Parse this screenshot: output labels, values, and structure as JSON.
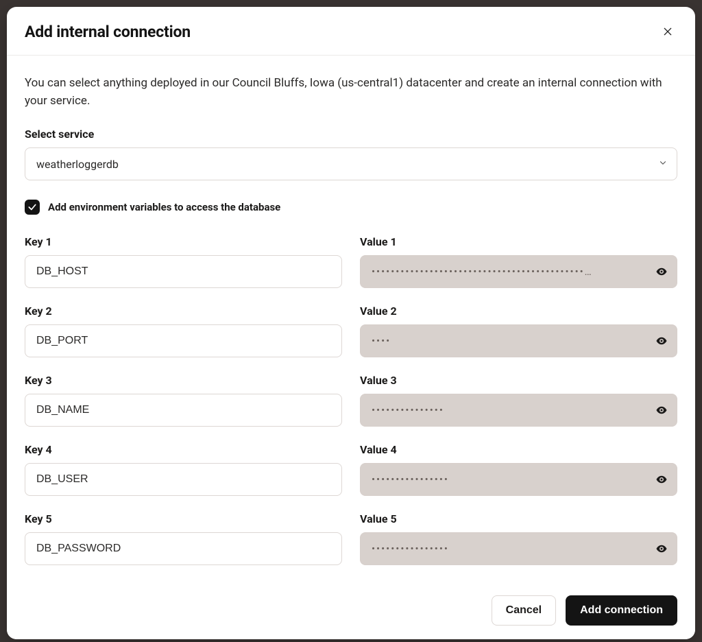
{
  "dialog": {
    "title": "Add internal connection",
    "intro": "You can select anything deployed in our Council Bluffs, Iowa (us-central1) datacenter and create an internal connection with your service.",
    "select_label": "Select service",
    "selected_service": "weatherloggerdb",
    "checkbox_label": "Add environment variables to access the database",
    "checkbox_checked": true,
    "pairs": [
      {
        "key_label": "Key 1",
        "value_label": "Value 1",
        "key": "DB_HOST",
        "mask": "••••••••••••••••••••••••••••••••••••••••••••…"
      },
      {
        "key_label": "Key 2",
        "value_label": "Value 2",
        "key": "DB_PORT",
        "mask": "••••"
      },
      {
        "key_label": "Key 3",
        "value_label": "Value 3",
        "key": "DB_NAME",
        "mask": "•••••••••••••••"
      },
      {
        "key_label": "Key 4",
        "value_label": "Value 4",
        "key": "DB_USER",
        "mask": "••••••••••••••••"
      },
      {
        "key_label": "Key 5",
        "value_label": "Value 5",
        "key": "DB_PASSWORD",
        "mask": "••••••••••••••••"
      }
    ],
    "cancel_label": "Cancel",
    "submit_label": "Add connection"
  },
  "icons": {
    "close": "close-icon",
    "chevron_down": "chevron-down-icon",
    "check": "check-icon",
    "eye": "eye-icon"
  }
}
